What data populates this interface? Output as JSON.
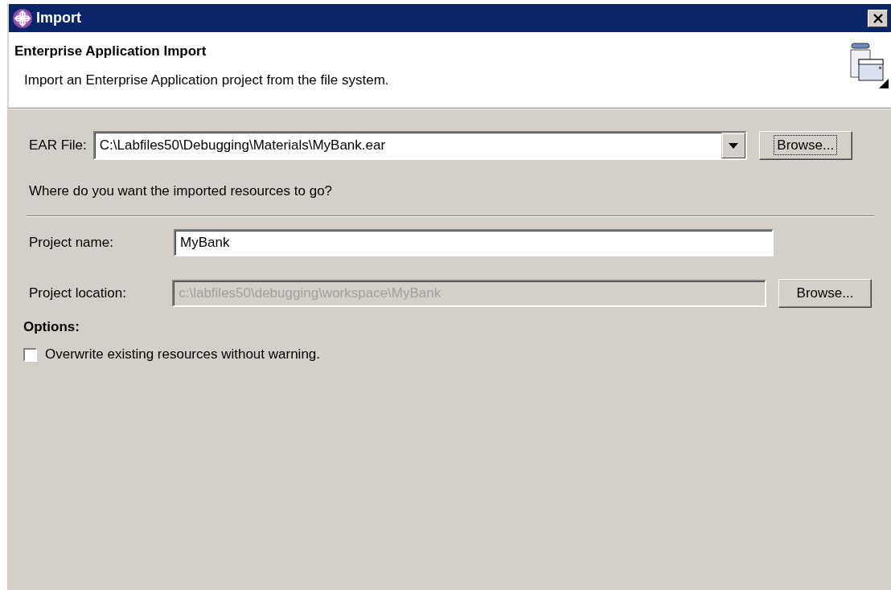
{
  "window": {
    "title": "Import"
  },
  "header": {
    "title": "Enterprise Application Import",
    "description": "Import an Enterprise Application project from the file system."
  },
  "ear_file": {
    "label": "EAR File:",
    "value": "C:\\Labfiles50\\Debugging\\Materials\\MyBank.ear",
    "browse_button": {
      "label": "Browse...",
      "focused": true
    }
  },
  "destination_prompt": "Where do you want the imported resources to go?",
  "project_name": {
    "label": "Project name:",
    "value": "MyBank"
  },
  "project_location": {
    "label": "Project location:",
    "value": "c:\\labfiles50\\debugging\\workspace\\MyBank",
    "disabled": true,
    "browse_button": {
      "label": "Browse...",
      "focused": false
    }
  },
  "options": {
    "title": "Options:",
    "checkboxes": [
      {
        "label": "Overwrite existing resources without warning.",
        "checked": false
      }
    ]
  }
}
